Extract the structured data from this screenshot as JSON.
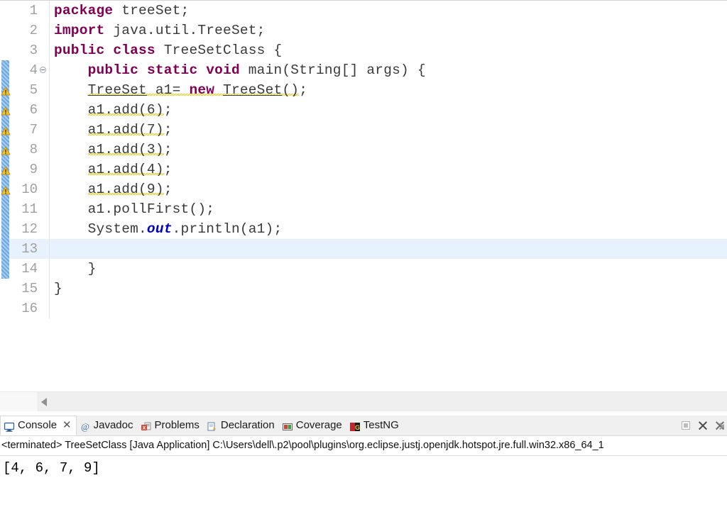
{
  "editor": {
    "name": "java-source-editor",
    "language": "java",
    "current_line": 13,
    "colors": {
      "keyword": "#7f0055",
      "field": "#0000c0",
      "text": "#3a3a3a",
      "line_number": "#a0a0a0",
      "current_line_highlight": "#e8f2fe",
      "change_bar": "#4a90d9",
      "warning_squiggle": "#e8c600"
    },
    "lines": [
      {
        "n": "1",
        "text": "package treeSet;",
        "marker": "none",
        "change": "none",
        "fold": false,
        "warn": false
      },
      {
        "n": "2",
        "text": "import java.util.TreeSet;",
        "marker": "none",
        "change": "none",
        "fold": false,
        "warn": false
      },
      {
        "n": "3",
        "text": "public class TreeSetClass {",
        "marker": "none",
        "change": "none",
        "fold": false,
        "warn": false
      },
      {
        "n": "4",
        "text": "    public static void main(String[] args) {",
        "marker": "none",
        "change": "hatch",
        "fold": true,
        "warn": false
      },
      {
        "n": "5",
        "text": "    TreeSet a1= new TreeSet();",
        "marker": "warning",
        "change": "hatch",
        "fold": false,
        "warn": true
      },
      {
        "n": "6",
        "text": "    a1.add(6);",
        "marker": "warning",
        "change": "hatch",
        "fold": false,
        "warn": true
      },
      {
        "n": "7",
        "text": "    a1.add(7);",
        "marker": "warning",
        "change": "hatch",
        "fold": false,
        "warn": true
      },
      {
        "n": "8",
        "text": "    a1.add(3);",
        "marker": "warning",
        "change": "hatch",
        "fold": false,
        "warn": true
      },
      {
        "n": "9",
        "text": "    a1.add(4);",
        "marker": "warning",
        "change": "hatch",
        "fold": false,
        "warn": true
      },
      {
        "n": "10",
        "text": "    a1.add(9);",
        "marker": "warning",
        "change": "hatch",
        "fold": false,
        "warn": true
      },
      {
        "n": "11",
        "text": "    a1.pollFirst();",
        "marker": "none",
        "change": "hatch",
        "fold": false,
        "warn": false
      },
      {
        "n": "12",
        "text": "    System.out.println(a1);",
        "marker": "none",
        "change": "hatch",
        "fold": false,
        "warn": false
      },
      {
        "n": "13",
        "text": "",
        "marker": "none",
        "change": "hatch",
        "fold": false,
        "warn": false
      },
      {
        "n": "14",
        "text": "    }",
        "marker": "none",
        "change": "hatch",
        "fold": false,
        "warn": false
      },
      {
        "n": "15",
        "text": "}",
        "marker": "none",
        "change": "none",
        "fold": false,
        "warn": false
      },
      {
        "n": "16",
        "text": "",
        "marker": "none",
        "change": "none",
        "fold": false,
        "warn": false
      }
    ]
  },
  "scrollbar": {
    "left_arrow_label": "scroll-left"
  },
  "console_panel": {
    "tabs": [
      {
        "label": "Console",
        "icon": "console-icon",
        "active": true,
        "closable": true
      },
      {
        "label": "Javadoc",
        "icon": "javadoc-icon",
        "active": false,
        "closable": false
      },
      {
        "label": "Problems",
        "icon": "problems-icon",
        "active": false,
        "closable": false
      },
      {
        "label": "Declaration",
        "icon": "declaration-icon",
        "active": false,
        "closable": false
      },
      {
        "label": "Coverage",
        "icon": "coverage-icon",
        "active": false,
        "closable": false
      },
      {
        "label": "TestNG",
        "icon": "testng-icon",
        "active": false,
        "closable": false
      }
    ],
    "close_glyph": "✕",
    "toolbar": [
      {
        "name": "terminate-button",
        "icon": "stop-square-icon",
        "enabled": false
      },
      {
        "name": "remove-launch-button",
        "icon": "close-x-icon",
        "enabled": true
      },
      {
        "name": "remove-all-terminated-button",
        "icon": "close-all-icon",
        "enabled": true
      }
    ],
    "process_line": "<terminated> TreeSetClass [Java Application] C:\\Users\\dell\\.p2\\pool\\plugins\\org.eclipse.justj.openjdk.hotspot.jre.full.win32.x86_64_1",
    "output": "[4, 6, 7, 9]"
  }
}
